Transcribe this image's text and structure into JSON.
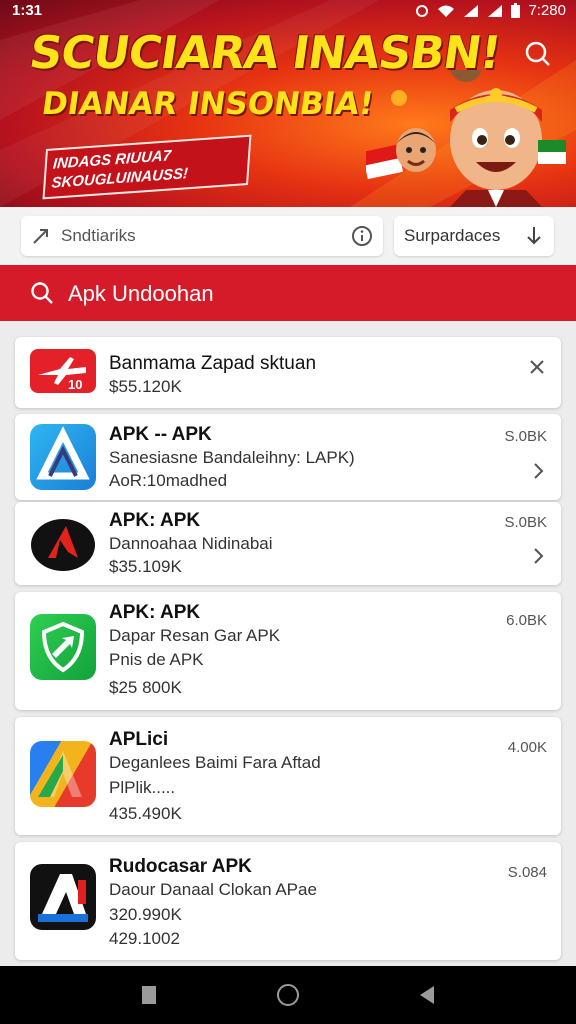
{
  "status": {
    "time": "1:31",
    "right": "7:280"
  },
  "banner": {
    "headline": "SCUCIARA INASBN!",
    "headline2": "DIANAR INSONBIA!",
    "tagline": [
      "INDAGS RIUUA7",
      "SKOUGLUINAUSS!"
    ]
  },
  "filters": {
    "left_text": "Sndtiariks",
    "right_text": "Surpardaces"
  },
  "search": {
    "text": "Apk Undoohan"
  },
  "cards": [
    {
      "title": "Banmama Zapad sktuan",
      "lines": [
        "$55.120K"
      ],
      "side": ""
    },
    {
      "title": "APK -- APK",
      "lines": [
        "Sanesiasne Bandaleihny: LAPK)",
        "AoR:10madhed"
      ],
      "side": "S.0BK"
    },
    {
      "title": "APK: APK",
      "lines": [
        "Dannoahaa Nidinabai",
        "$35.109K"
      ],
      "side": "S.0BK"
    },
    {
      "title": "APK: APK",
      "lines": [
        "Dapar Resan Gar APK",
        "Pnis de APK",
        "$25 800K"
      ],
      "side": "6.0BK"
    },
    {
      "title": "APLici",
      "lines": [
        "Deganlees Baimi Fara Aftad",
        "PlPlik.....",
        "435.490K"
      ],
      "side": "4.00K"
    },
    {
      "title": "Rudocasar APK",
      "lines": [
        "Daour Danaal Clokan APae",
        "320.990K",
        "429.1002"
      ],
      "side": "S.084"
    }
  ],
  "colors": {
    "brand_red": "#d51a2a",
    "banner_yellow": "#ffe31a"
  },
  "icons": [
    "search-icon",
    "trend-arrow-icon",
    "info-icon",
    "download-icon",
    "close-icon",
    "chevron-right-icon",
    "back-icon",
    "home-icon",
    "recent-icon"
  ]
}
